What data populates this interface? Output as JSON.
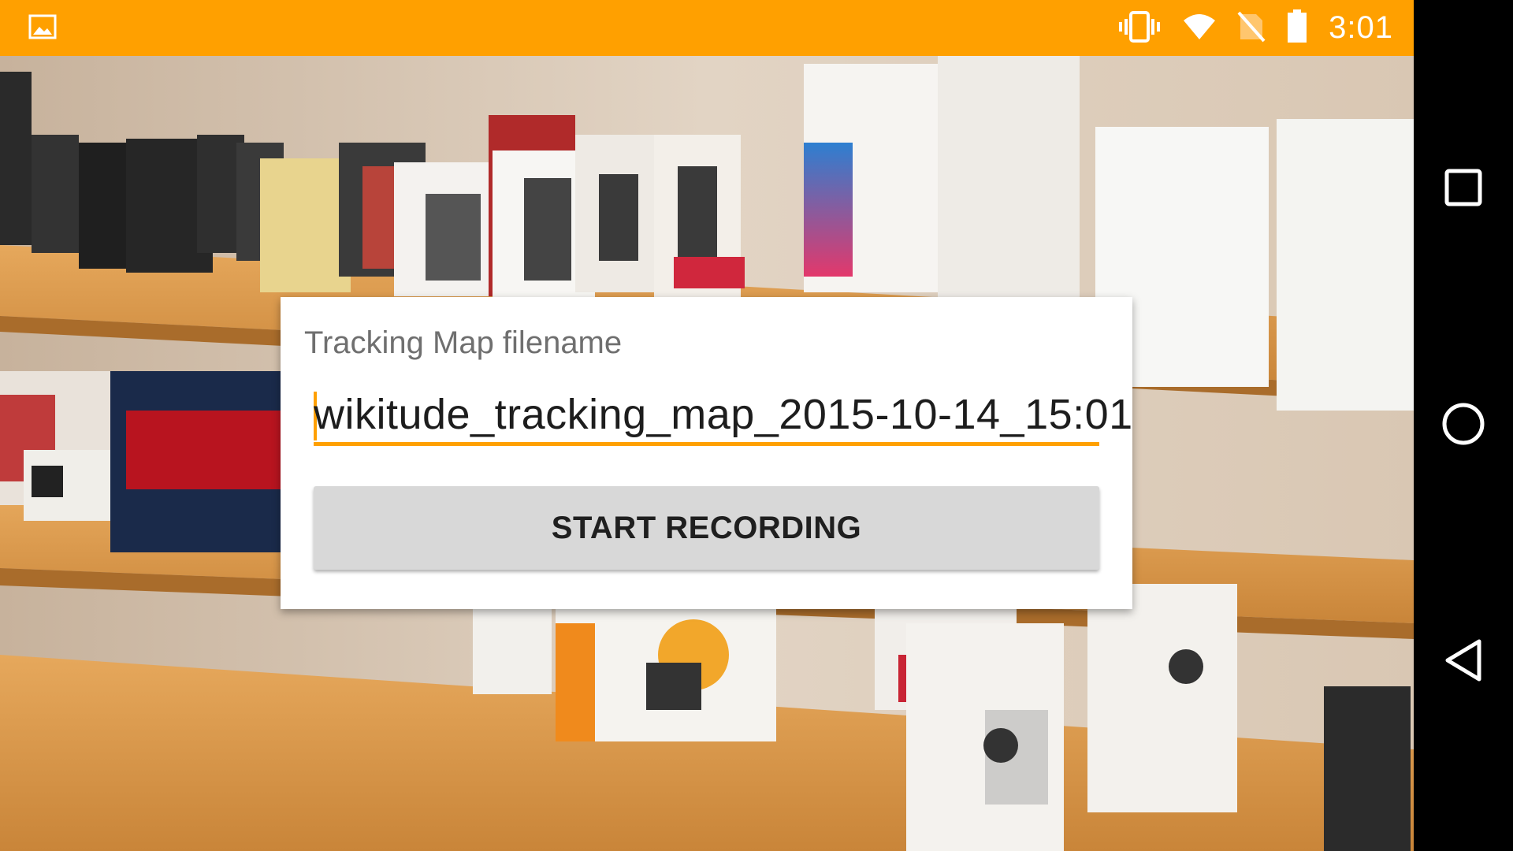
{
  "status_bar": {
    "time": "3:01",
    "background": "#FFA000",
    "icons": [
      "image-notification-icon",
      "vibrate-icon",
      "wifi-icon",
      "no-sim-icon",
      "battery-icon"
    ]
  },
  "dialog": {
    "label": "Tracking Map filename",
    "filename_value": "wikitude_tracking_map_2015-10-14_15:01",
    "button_label": "START RECORDING",
    "accent": "#FFA000"
  },
  "nav_bar": {
    "buttons": [
      "recents-icon",
      "home-icon",
      "back-icon"
    ]
  }
}
